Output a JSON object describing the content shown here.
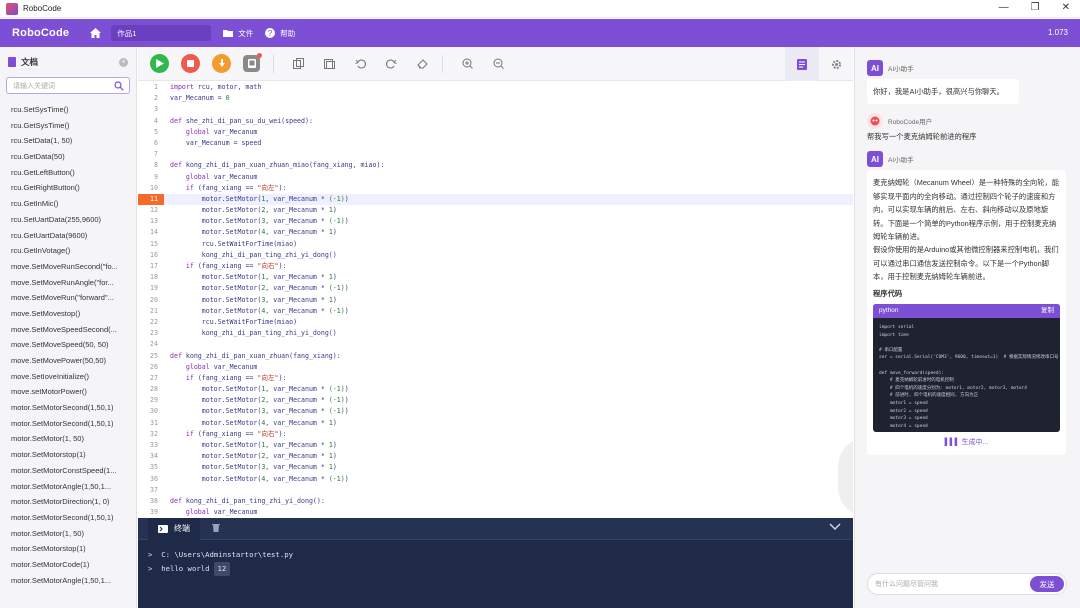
{
  "window": {
    "title": "RoboCode",
    "minimize": "—",
    "maximize": "❐",
    "close": "✕"
  },
  "menubar": {
    "brand": "RoboCode",
    "project_name": "作品1",
    "file": "文件",
    "help": "帮助",
    "version": "1.073"
  },
  "left": {
    "title": "文档",
    "search_placeholder": "请输入关键词",
    "items": [
      "rcu.SetSysTime()",
      "rcu.GetSysTime()",
      "rcu.SetData(1, 50)",
      "rcu.GetData(50)",
      "rcu.GetLeftButton()",
      "rcu.GetRightButton()",
      "rcu.GetInMic()",
      "rcu.SetUartData(255,9600)",
      "rcu.GetUartData(9600)",
      "rcu.GetInVotage()",
      "move.SetMoveRunSecond(\"fo...",
      "move.SetMoveRunAngle(\"for...",
      "move.SetMoveRun(\"forward\"...",
      "move.SetMovestop()",
      "move.SetMoveSpeedSecond(...",
      "move.SetMoveSpeed(50, 50)",
      "move.SetMovePower(50,50)",
      "move.SetIoveInitialize()",
      "move.setMotorPower()",
      "motor.SetMotorSecond(1,50,1)",
      "motor.SetMotorSecond(1,50,1)",
      "motor.SetMotor(1, 50)",
      "motor.SetMotorstop(1)",
      "motor.SetMotorConstSpeed(1...",
      "motor.SetMotorAngle(1,50,1...",
      "motor.SetMotorDirection(1, 0)",
      "motor.SetMotorSecond(1,50,1)",
      "motor.SetMotor(1, 50)",
      "motor.SetMotorstop(1)",
      "motor.SetMotorCode(1)",
      "motor.SetMotorAngle(1,50,1..."
    ]
  },
  "editor": {
    "highlight_line": 11,
    "lines": [
      "import rcu, motor, math",
      "var_Mecanum = 0",
      "",
      "def she_zhi_di_pan_su_du_wei(speed):",
      "    global var_Mecanum",
      "    var_Mecanum = speed",
      "",
      "def kong_zhi_di_pan_xuan_zhuan_miao(fang_xiang, miao):",
      "    global var_Mecanum",
      "    if (fang_xiang == \"向左\"):",
      "        motor.SetMotor(1, var_Mecanum * (-1))",
      "        motor.SetMotor(2, var_Mecanum * 1)",
      "        motor.SetMotor(3, var_Mecanum * (-1))",
      "        motor.SetMotor(4, var_Mecanum * 1)",
      "        rcu.SetWaitForTime(miao)",
      "        kong_zhi_di_pan_ting_zhi_yi_dong()",
      "    if (fang_xiang == \"向右\"):",
      "        motor.SetMotor(1, var_Mecanum * 1)",
      "        motor.SetMotor(2, var_Mecanum * (-1))",
      "        motor.SetMotor(3, var_Mecanum * 1)",
      "        motor.SetMotor(4, var_Mecanum * (-1))",
      "        rcu.SetWaitForTime(miao)",
      "        kong_zhi_di_pan_ting_zhi_yi_dong()",
      "",
      "def kong_zhi_di_pan_xuan_zhuan(fang_xiang):",
      "    global var_Mecanum",
      "    if (fang_xiang == \"向左\"):",
      "        motor.SetMotor(1, var_Mecanum * (-1))",
      "        motor.SetMotor(2, var_Mecanum * (-1))",
      "        motor.SetMotor(3, var_Mecanum * (-1))",
      "        motor.SetMotor(4, var_Mecanum * 1)",
      "    if (fang_xiang == \"向右\"):",
      "        motor.SetMotor(1, var_Mecanum * 1)",
      "        motor.SetMotor(2, var_Mecanum * 1)",
      "        motor.SetMotor(3, var_Mecanum * 1)",
      "        motor.SetMotor(4, var_Mecanum * (-1))",
      "",
      "def kong_zhi_di_pan_ting_zhi_yi_dong():",
      "    global var_Mecanum"
    ]
  },
  "ai_float": "AI",
  "terminal": {
    "title": "终端",
    "path": "C: \\Users\\Adminstartor\\test.py",
    "output": "hello world",
    "count": "12",
    "prompt": ">"
  },
  "chat": {
    "ai_name": "AI小助手",
    "ai_badge": "AI",
    "greeting": "你好，我是AI小助手，很高兴与你聊天。",
    "user_name": "RoboCode用户",
    "user_msg": "帮我写一个麦克纳姆轮前进的程序",
    "answer_p1": "麦克纳姆轮（Mecanum Wheel）是一种特殊的全向轮，能够实现平面内的全向移动。通过控制四个轮子的速度和方向，可以实现车辆的前后、左右、斜向移动以及原地旋转。下面是一个简单的Python程序示例，用于控制麦克纳姆轮车辆前进。",
    "answer_p2": "假设你使用的是Arduino或其他微控制器来控制电机，我们可以通过串口通信发送控制命令。以下是一个Python脚本，用于控制麦克纳姆轮车辆前进。",
    "code_title": "程序代码",
    "code_lang": "python",
    "copy_label": "复制",
    "code": "import serial\nimport time\n\n# 串口配置\nser = serial.Serial('COM3', 9600, timeout=1)  # 根据实际情况修改串口号\n\ndef move_forward(speed):\n    # 麦克纳姆轮前进时的电机控制\n    # 四个电机的速度分别为: motor1, motor2, motor3, motor4\n    # 前进时, 四个电机的速度相同, 方向为正\n    motor1 = speed\n    motor2 = speed\n    motor3 = speed\n    motor4 = speed",
    "generating": "生成中...",
    "input_placeholder": "有什么问题尽管问我",
    "send": "发送"
  },
  "colors": {
    "accent": "#7c4fd4",
    "run": "#2fb84b",
    "stop": "#ef5a4e",
    "download": "#f39b2c",
    "highlight": "#f56a2b"
  }
}
